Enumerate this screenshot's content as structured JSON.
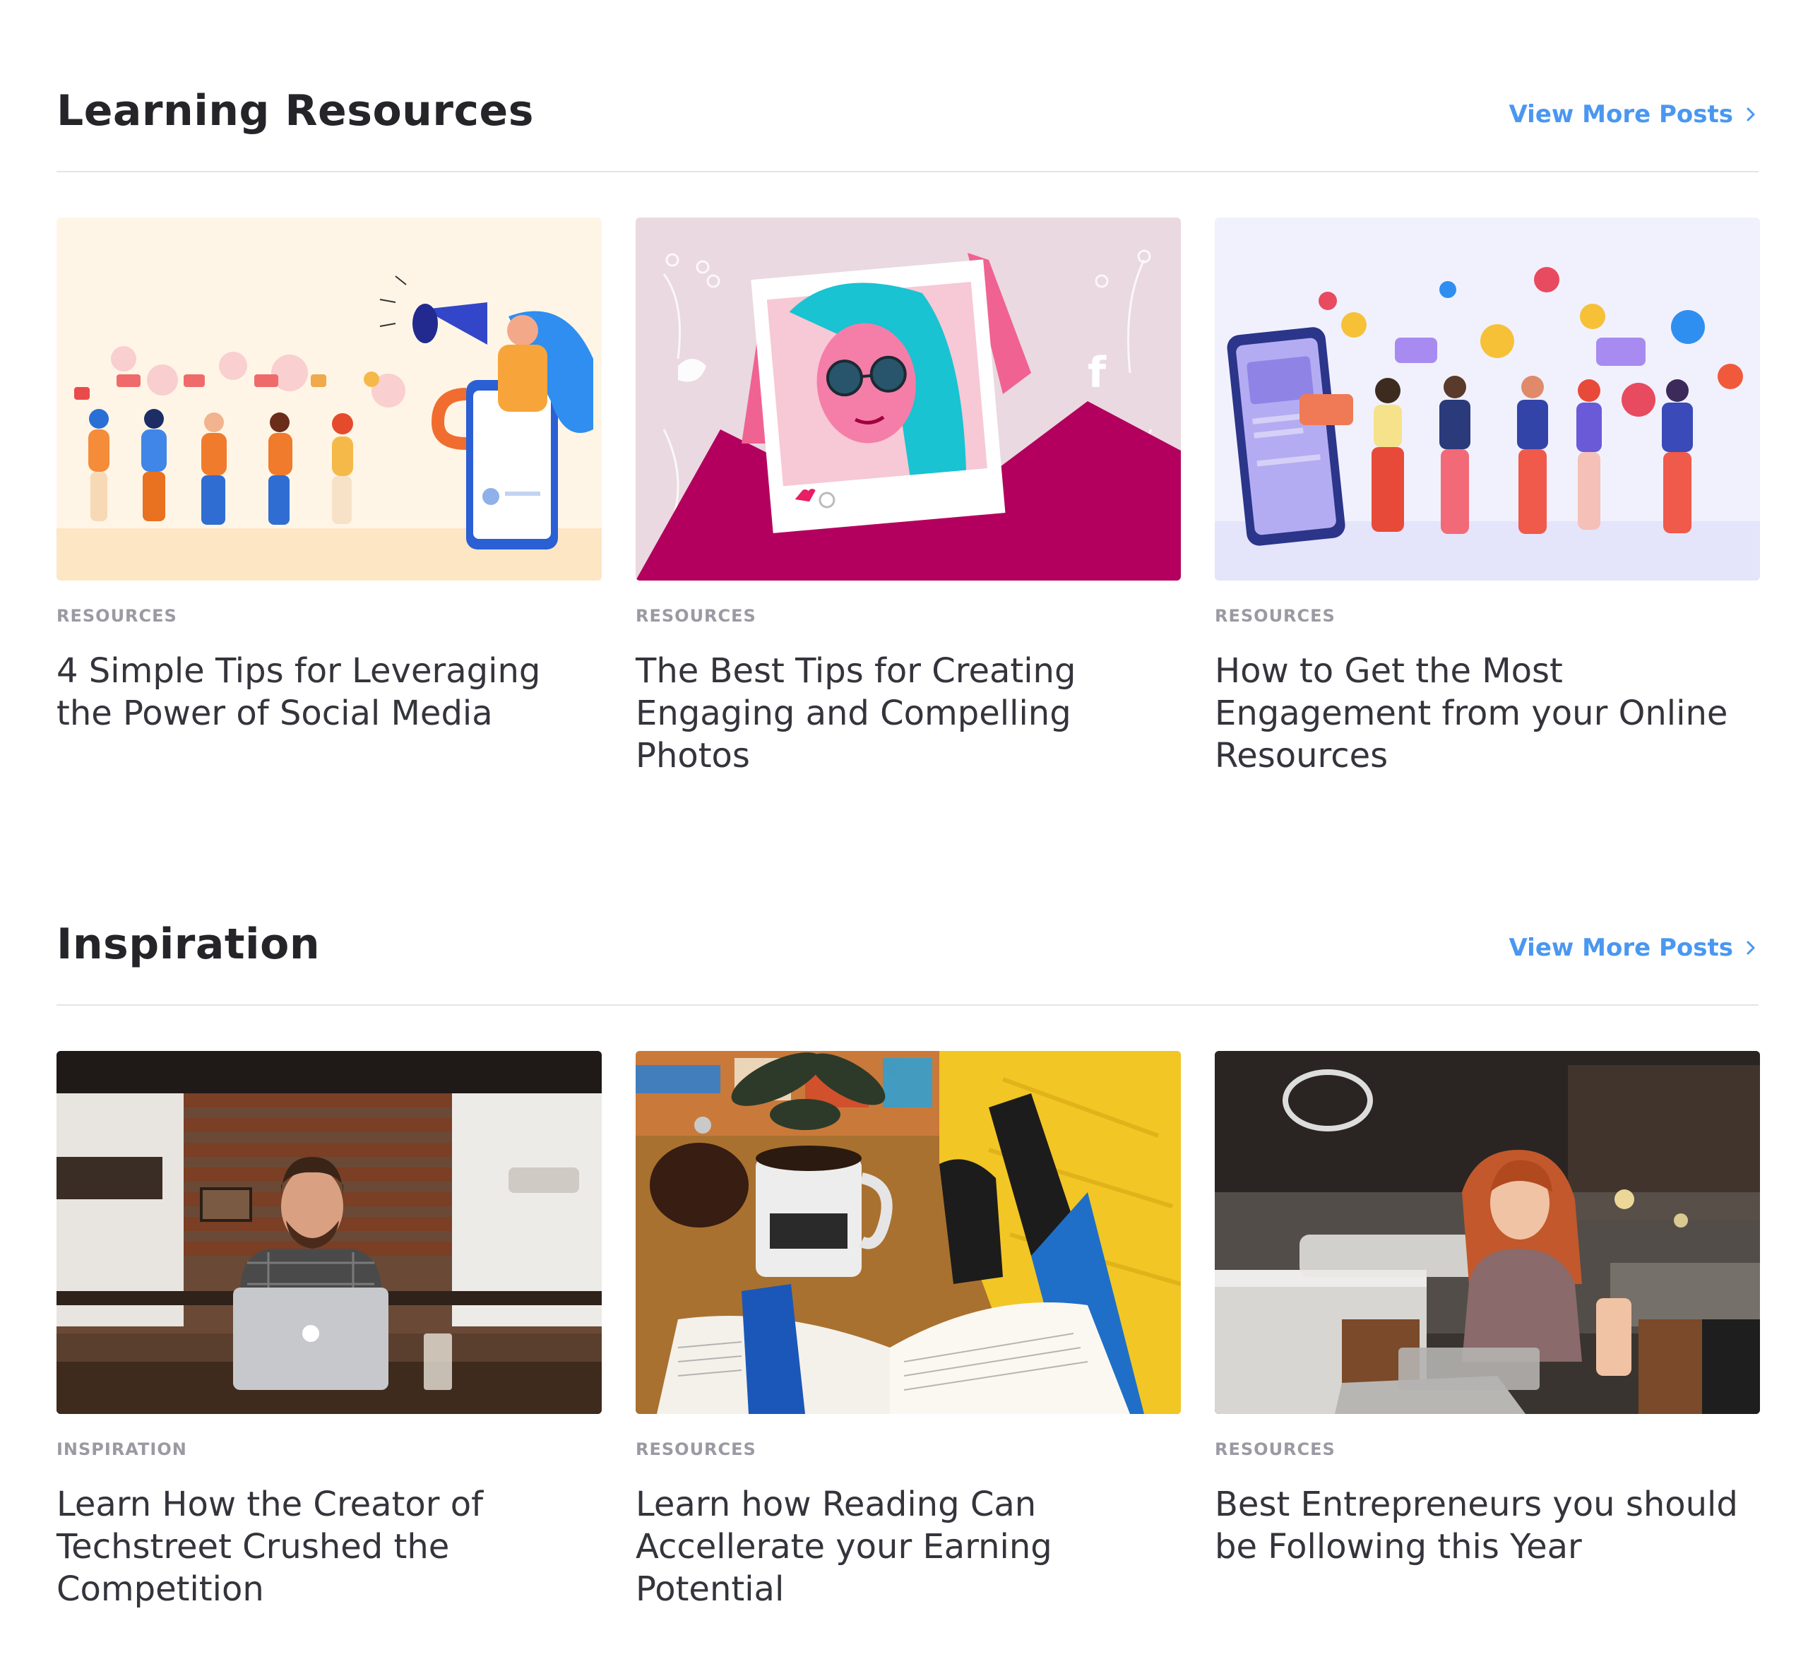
{
  "sections": [
    {
      "title": "Learning Resources",
      "view_more": "View More Posts",
      "cards": [
        {
          "category": "RESOURCES",
          "title": "4 Simple Tips for Leveraging the Power of Social Media",
          "image": "social-media-megaphone-illustration"
        },
        {
          "category": "RESOURCES",
          "title": "The Best Tips for Creating Engaging and Compelling Photos",
          "image": "photo-frame-illustration"
        },
        {
          "category": "RESOURCES",
          "title": "How to Get the Most Engagement from your Online Resources",
          "image": "engagement-people-illustration"
        }
      ]
    },
    {
      "title": "Inspiration",
      "view_more": "View More Posts",
      "cards": [
        {
          "category": "INSPIRATION",
          "title": "Learn How the Creator of Techstreet Crushed the Competition",
          "image": "man-laptop-cafe-photo"
        },
        {
          "category": "RESOURCES",
          "title": "Learn how Reading Can Accellerate your Earning Potential",
          "image": "book-coffee-photo"
        },
        {
          "category": "RESOURCES",
          "title": "Best Entrepreneurs you should be Following this Year",
          "image": "woman-laptop-cafe-photo"
        }
      ]
    }
  ],
  "colors": {
    "accent": "#4a97f0",
    "heading": "#252529",
    "category": "#9b9aa3",
    "divider": "#e4e4e8"
  }
}
